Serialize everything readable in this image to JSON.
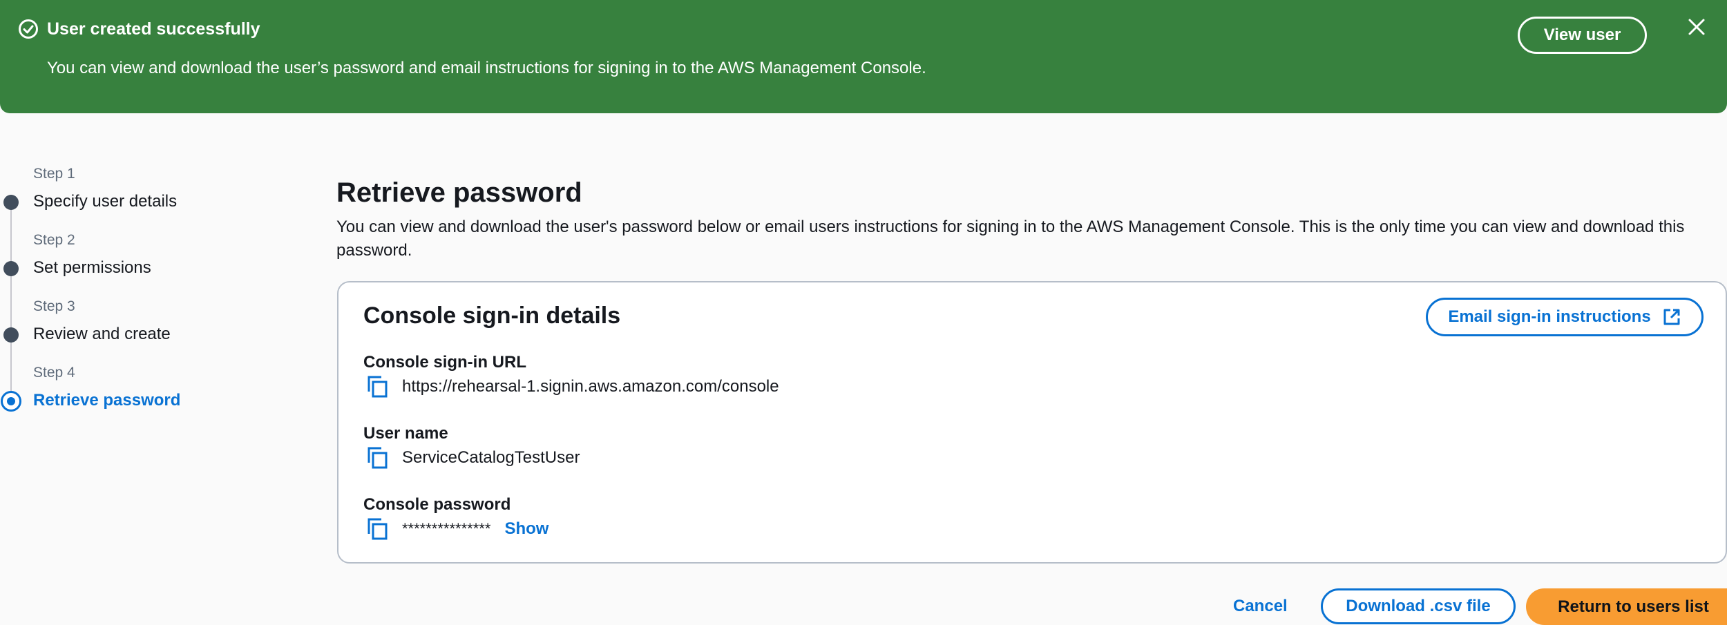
{
  "flash": {
    "title": "User created successfully",
    "message": "You can view and download the user’s password and email instructions for signing in to the AWS Management Console.",
    "view_user_label": "View user",
    "color": "#37813e"
  },
  "steps": [
    {
      "number": "Step 1",
      "label": "Specify user details"
    },
    {
      "number": "Step 2",
      "label": "Set permissions"
    },
    {
      "number": "Step 3",
      "label": "Review and create"
    },
    {
      "number": "Step 4",
      "label": "Retrieve password",
      "active": true
    }
  ],
  "main": {
    "title": "Retrieve password",
    "description": "You can view and download the user's password below or email users instructions for signing in to the AWS Management Console. This is the only time you can view and download this password."
  },
  "card": {
    "title": "Console sign-in details",
    "email_button_label": "Email sign-in instructions",
    "fields": {
      "url_label": "Console sign-in URL",
      "url_value": "https://rehearsal-1.signin.aws.amazon.com/console",
      "username_label": "User name",
      "username_value": "ServiceCatalogTestUser",
      "password_label": "Console password",
      "password_value": "***************",
      "show_label": "Show"
    }
  },
  "footer": {
    "cancel_label": "Cancel",
    "download_label": "Download .csv file",
    "return_label": "Return to users list"
  },
  "colors": {
    "link_blue": "#0972d3",
    "primary_orange": "#f89c32"
  }
}
